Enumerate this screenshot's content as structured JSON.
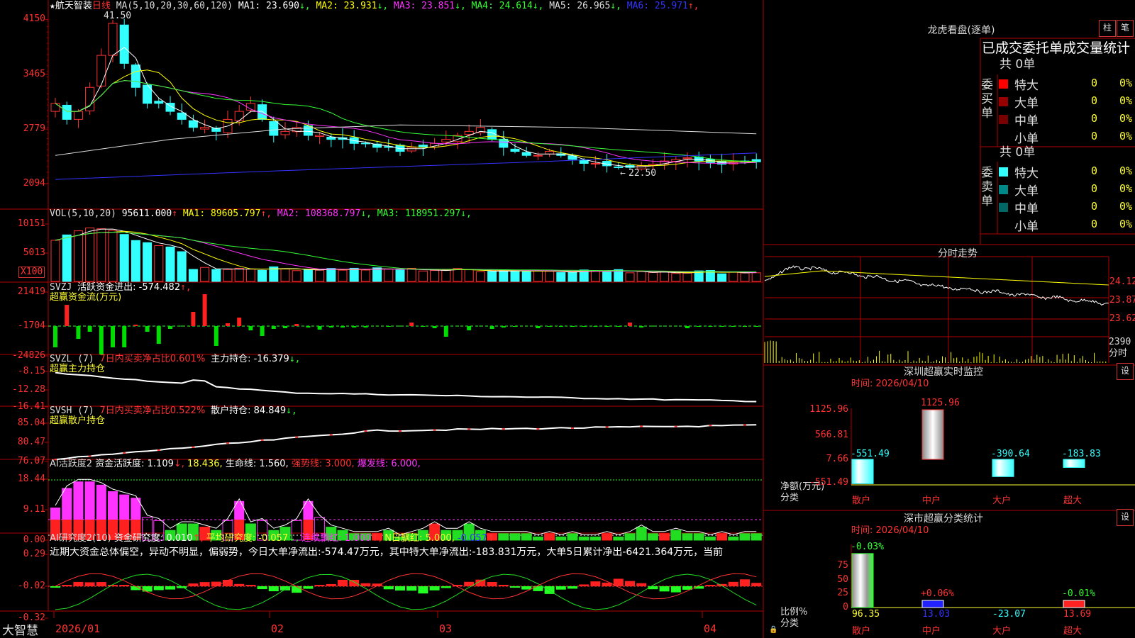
{
  "stock": {
    "name": "航天智装",
    "period": "日线",
    "star": "★"
  },
  "main": {
    "ma_label": "MA(5,10,20,30,60,120)",
    "ma": [
      {
        "label": "MA1: 23.690",
        "arrow": "↓",
        "color": "#ffffff"
      },
      {
        "label": "MA2: 23.931",
        "arrow": "↓",
        "color": "#ffff00"
      },
      {
        "label": "MA3: 23.851",
        "arrow": "↓",
        "color": "#ff33ff"
      },
      {
        "label": "MA4: 24.614",
        "arrow": "↓",
        "color": "#33ff33"
      },
      {
        "label": "MA5: 26.965",
        "arrow": "↓",
        "color": "#dddddd"
      },
      {
        "label": "MA6: 25.971",
        "arrow": "↑",
        "color": "#3333ff"
      }
    ],
    "y_ticks": [
      "4150",
      "3465",
      "2779",
      "2094"
    ],
    "y_values": [
      41.5,
      34.65,
      27.79,
      20.94
    ],
    "high_label": "41.50",
    "low_label": "22.50",
    "ylim": [
      20.0,
      42.5
    ]
  },
  "vol": {
    "title": "VOL(5,10,20)",
    "value": "95611.000",
    "value_arrow": "↑",
    "ma": [
      {
        "label": "MA1: 89605.797",
        "arrow": "↑",
        "color": "#ffff00"
      },
      {
        "label": "MA2: 108368.797",
        "arrow": "↓",
        "color": "#ff33ff"
      },
      {
        "label": "MA3: 118951.297",
        "arrow": "↓",
        "color": "#33ff33"
      }
    ],
    "y_ticks": [
      "10151",
      "5013"
    ],
    "unit": "X100"
  },
  "svzj": {
    "title": "SVZJ",
    "line1": "活跃资金进出: -574.482",
    "line1_arrow": "↑,",
    "line2": "超赢资金流(万元)",
    "y_ticks": [
      "21419",
      "-1704",
      "-24826"
    ]
  },
  "svzl": {
    "title": "SVZL (7)",
    "t1": "7日内买卖净占比0.601%",
    "t2": "主力持仓: -16.379",
    "t2_arrow": "↓,",
    "t3": "超赢主力持仓",
    "y_ticks": [
      "-8.15",
      "-12.28",
      "-16.41"
    ]
  },
  "svsh": {
    "title": "SVSH (7)",
    "t1": "7日内买卖净占比0.522%",
    "t2": "散户持仓: 84.849",
    "t2_arrow": "↓,",
    "t3": "超赢散户持仓",
    "y_ticks": [
      "85.04",
      "80.47",
      "76.07"
    ]
  },
  "ai1": {
    "title": "AI活跃度2",
    "t1": "资金活跃度: 1.109",
    "t1_arrow": "↓,",
    "t2": "18.436,",
    "t3": "生命线: 1.560,",
    "t4": "强势线: 3.000,",
    "t5": "爆发线: 6.000,",
    "y_ticks": [
      "18.44",
      "9.11",
      "0.00"
    ]
  },
  "ai2": {
    "title": "AI研究度2(10)",
    "t1": "资金研究度: 0.010",
    "t1_arrow": "↑,",
    "t2": "平均研究度: -0.057",
    "t2_arrow": "↓,",
    "t3": "连续飘红: 1.000",
    "t3_arrow": "↑,",
    "t4": "N日飘红: 5.000,",
    "t5": "-0.057",
    "t5_arrow": "↑",
    "comment": "近期大资金总体偏空，异动不明显，偏弱势，今日大单净流出:-574.47万元，其中特大单净流出:-183.831万元，大单5日累计净出-6421.364万元，当前",
    "y_ticks": [
      "0.29",
      "-0.02",
      "-0.32"
    ]
  },
  "xaxis": {
    "labels": [
      "2026/01",
      "02",
      "03",
      "04"
    ]
  },
  "brand": "大智慧",
  "lhb": {
    "title": "龙虎看盘(逐单)",
    "btn_bar": "柱",
    "btn_tick": "笔",
    "header": "已成交委托单成交量统计",
    "buy": {
      "label": "委买单",
      "total": "共 0单",
      "rows": [
        {
          "name": "特大",
          "value": "0",
          "pct": "0%",
          "color": "#ff0000"
        },
        {
          "name": "大单",
          "value": "0",
          "pct": "0%",
          "color": "#990000"
        },
        {
          "name": "中单",
          "value": "0",
          "pct": "0%",
          "color": "#770000"
        },
        {
          "name": "小单",
          "value": "0",
          "pct": "0%",
          "color": ""
        }
      ]
    },
    "sell": {
      "label": "委卖单",
      "total": "共 0单",
      "rows": [
        {
          "name": "特大",
          "value": "0",
          "pct": "0%",
          "color": "#33ffff"
        },
        {
          "name": "大单",
          "value": "0",
          "pct": "0%",
          "color": "#008888"
        },
        {
          "name": "中单",
          "value": "0",
          "pct": "0%",
          "color": "#006666"
        },
        {
          "name": "小单",
          "value": "0",
          "pct": "0%",
          "color": ""
        }
      ]
    }
  },
  "intraday": {
    "title": "分时走势",
    "y_ticks": [
      "24.12",
      "23.87",
      "23.62"
    ],
    "vol_tick": "2390",
    "vol_unit": "分时"
  },
  "sz_monitor": {
    "title": "深圳超赢实时监控",
    "btn": "设",
    "time": "时间: 2026/04/10",
    "y_ticks": [
      "1125.96",
      "566.81",
      "7.66",
      "-551.49"
    ],
    "ylabel": "净额(万元)",
    "xlabel": "分类",
    "chart_data": {
      "type": "bar",
      "categories": [
        "散户",
        "中户",
        "大户",
        "超大"
      ],
      "values": [
        -551.49,
        1125.96,
        -390.64,
        -183.83
      ],
      "value_labels": [
        "-551.49",
        "1125.96",
        "-390.64",
        "-183.83"
      ],
      "ylim": [
        -551.49,
        1125.96
      ]
    }
  },
  "sz_class": {
    "title": "深市超赢分类统计",
    "btn": "设",
    "time": "时间: 2026/04/10",
    "y_ticks": [
      "75",
      "50",
      "25",
      "0"
    ],
    "ylabel": "比例%",
    "xlabel": "分类",
    "chart_data": {
      "type": "bar",
      "categories": [
        "散户",
        "中户",
        "大户",
        "超大"
      ],
      "values": [
        96.35,
        13.03,
        -23.07,
        13.69
      ],
      "value_labels": [
        "96.35",
        "13.03",
        "-23.07",
        "13.69"
      ],
      "top_labels": [
        "-0.03%",
        "+0.06%",
        "",
        "-0.01%"
      ],
      "ylim": [
        0,
        100
      ]
    }
  },
  "colors": {
    "up": "#ff3333",
    "down": "#33ffff",
    "grid": "#b00000",
    "axis": "#ff3030"
  }
}
